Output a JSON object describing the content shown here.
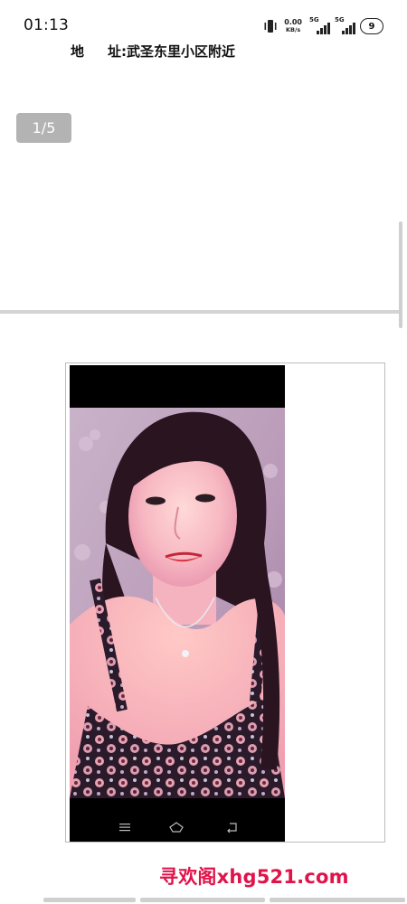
{
  "status_bar": {
    "time": "01:13",
    "net_speed_value": "0.00",
    "net_speed_unit": "KB/s",
    "sim1_type": "5G",
    "sim2_type": "5G",
    "battery_level": "9",
    "icons": [
      "vibrate-icon",
      "signal-icon",
      "battery-icon"
    ]
  },
  "post": {
    "address_label_1": "地",
    "address_label_2": "址:",
    "address_value": "武圣东里小区附近",
    "page_indicator": "1/5",
    "photo_alt": "selfie photo"
  },
  "embedded_phone_nav": {
    "icons": [
      "menu-icon",
      "home-icon",
      "back-icon"
    ]
  },
  "watermark": {
    "text": "寻欢阁xhg521.com",
    "color": "#e0134a"
  }
}
